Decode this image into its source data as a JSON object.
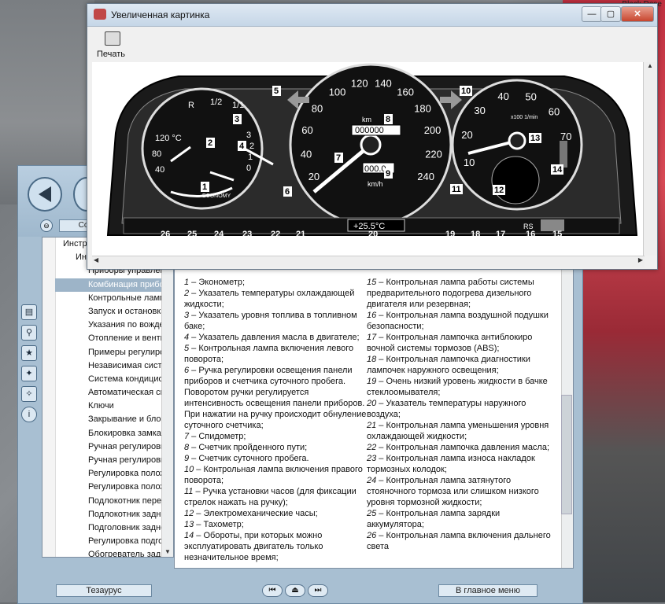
{
  "desktop": {
    "corner_label": "Black Dese"
  },
  "main_app": {
    "so_button": "Со",
    "tree": {
      "items": [
        {
          "label": "Инструк",
          "level": 0
        },
        {
          "label": "Инс",
          "level": 1
        },
        {
          "label": "Приборы управления",
          "level": 2
        },
        {
          "label": "Комбинация прибор",
          "level": 2,
          "selected": true
        },
        {
          "label": "Контрольные лампоч",
          "level": 2
        },
        {
          "label": "Запуск и остановка д",
          "level": 2
        },
        {
          "label": "Указания по вожден",
          "level": 2
        },
        {
          "label": "Отопление и вентиля",
          "level": 2
        },
        {
          "label": "Примеры регулировки",
          "level": 2
        },
        {
          "label": "Независимая систем",
          "level": 2
        },
        {
          "label": "Система кондициони",
          "level": 2
        },
        {
          "label": "Автоматическая сист",
          "level": 2
        },
        {
          "label": "Ключи",
          "level": 2
        },
        {
          "label": "Закрывание и блоки",
          "level": 2
        },
        {
          "label": "Блокировка замка з",
          "level": 2
        },
        {
          "label": "Ручная регулировка",
          "level": 2
        },
        {
          "label": "Ручная регулировка",
          "level": 2
        },
        {
          "label": "Регулировка положе",
          "level": 2
        },
        {
          "label": "Регулировка положе",
          "level": 2
        },
        {
          "label": "Подлокотник передн",
          "level": 2
        },
        {
          "label": "Подлокотник заднег",
          "level": 2
        },
        {
          "label": "Подголовник заднег",
          "level": 2
        },
        {
          "label": "Регулировка подголо",
          "level": 2
        },
        {
          "label": "Обогреватель задне",
          "level": 2
        }
      ]
    },
    "legend_left": [
      {
        "num": "1",
        "text": "– Эконометр;"
      },
      {
        "num": "2",
        "text": "– Указатель температуры охлаждающей жидкости;"
      },
      {
        "num": "3",
        "text": "– Указатель уровня топлива в топливном баке;"
      },
      {
        "num": "4",
        "text": "– Указатель давления масла в двигателе;"
      },
      {
        "num": "5",
        "text": "– Контрольная лампа включения левого поворота;"
      },
      {
        "num": "6",
        "text": "– Ручка регулировки освещения панели приборов и счетчика суточного пробега. Поворотом ручки регулируется интенсивность освещения панели приборов.  При нажатии на ручку происходит обнуление суточного счетчика;"
      },
      {
        "num": "7",
        "text": "– Спидометр;"
      },
      {
        "num": "8",
        "text": "– Счетчик пройденного пути;"
      },
      {
        "num": "9",
        "text": "– Счетчик суточного пробега."
      },
      {
        "num": "10",
        "text": "– Контрольная лампа включения правого поворота;"
      },
      {
        "num": "11",
        "text": "– Ручка установки часов (для фиксации стрелок нажать на ручку);"
      },
      {
        "num": "12",
        "text": "– Электромеханические часы;"
      },
      {
        "num": "13",
        "text": "– Тахометр;"
      },
      {
        "num": "14",
        "text": "– Обороты, при которых можно эксплуатировать двигатель только незначительное время;"
      }
    ],
    "legend_right": [
      {
        "num": "15",
        "text": "– Контрольная лампа работы системы предварительного подогрева дизельного двигателя или резервная;"
      },
      {
        "num": "16",
        "text": "– Контрольная лампа воздушной подушки безопасности;"
      },
      {
        "num": "17",
        "text": "– Контрольная лампочка антиблокиро вочной системы тормозов (ABS);"
      },
      {
        "num": "18",
        "text": "– Контрольная лампочка диагностики лампочек наружного освещения;"
      },
      {
        "num": "19",
        "text": "– Очень низкий уровень жидкости в бачке стеклоомывателя;"
      },
      {
        "num": "20",
        "text": "– Указатель температуры наружного воздуха;"
      },
      {
        "num": "21",
        "text": "– Контрольная лампа уменьшения уровня охлаждающей жидкости;"
      },
      {
        "num": "22",
        "text": "– Контрольная лампочка давления масла;"
      },
      {
        "num": "23",
        "text": "– Контрольная лампа износа накладок тормозных колодок;"
      },
      {
        "num": "24",
        "text": "– Контрольная лампа затянутого стояночного тормоза или слишком низкого уровня тормозной жидкости;"
      },
      {
        "num": "25",
        "text": "– Контрольная лампа зарядки аккумулятора;"
      },
      {
        "num": "26",
        "text": "– Контрольная лампа включения дальнего света"
      }
    ],
    "bottom": {
      "thesaurus": "Тезаурус",
      "main_menu": "В главное меню",
      "media_prev": "⏮",
      "media_eject": "⏏",
      "media_next": "⏭"
    }
  },
  "picture_window": {
    "title": "Увеличенная картинка",
    "print_label": "Печать",
    "close_glyph": "✕",
    "max_glyph": "▢",
    "min_glyph": "—",
    "dashboard": {
      "fuel_scale": [
        "R",
        "1/2",
        "1/1"
      ],
      "temp_scale": [
        "120 °C",
        "80",
        "40"
      ],
      "oil_scale": [
        "3",
        "2",
        "1",
        "0"
      ],
      "economy_label": "ECONOMY",
      "speed_scale": [
        "20",
        "40",
        "60",
        "80",
        "100",
        "120",
        "140",
        "160",
        "180",
        "200",
        "220",
        "240"
      ],
      "speed_unit_top": "km",
      "speed_unit_bottom": "km/h",
      "odometer": "000000",
      "trip": "000.0",
      "tacho_scale": [
        "10",
        "20",
        "30",
        "40",
        "50",
        "60",
        "70"
      ],
      "tacho_unit": "x100 1/min",
      "outside_temp": "+25.5°C",
      "rs_label": "RS",
      "callouts": [
        "1",
        "2",
        "3",
        "4",
        "5",
        "6",
        "7",
        "8",
        "9",
        "10",
        "11",
        "12",
        "13",
        "14",
        "15",
        "16",
        "17",
        "18",
        "19",
        "20",
        "21",
        "22",
        "23",
        "24",
        "25",
        "26"
      ]
    }
  }
}
